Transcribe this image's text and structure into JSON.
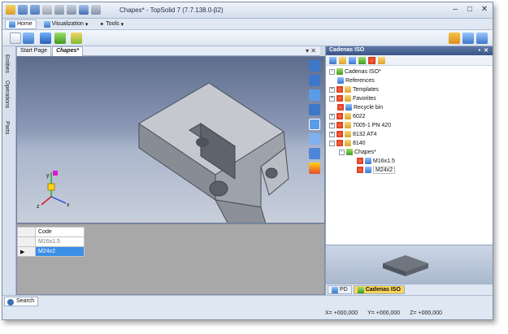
{
  "window": {
    "title": "Chapes* - TopSolid 7 (7.7.138.0-β2)"
  },
  "menu": {
    "tabs": [
      {
        "label": "Home"
      },
      {
        "label": "Visualization"
      },
      {
        "label": "Tools"
      }
    ]
  },
  "doc_tabs": [
    {
      "label": "Start Page"
    },
    {
      "label": "Chapes*"
    }
  ],
  "left_tabs": [
    {
      "label": "Entities"
    },
    {
      "label": "Operations"
    },
    {
      "label": "Parts"
    }
  ],
  "axes": {
    "y": "y",
    "x": "x",
    "z": "z"
  },
  "grid": {
    "header": "Code",
    "rows": [
      {
        "code": "M16x1.5"
      },
      {
        "code": "M24x2"
      }
    ]
  },
  "search": {
    "label": "Search"
  },
  "panel": {
    "title": "Cadenas ISO",
    "tree": [
      {
        "label": "Cadenas ISO*"
      },
      {
        "label": "References"
      },
      {
        "label": "Templates"
      },
      {
        "label": "Favorites"
      },
      {
        "label": "Recycle bin"
      },
      {
        "label": "6022"
      },
      {
        "label": "7005-1 PN 420"
      },
      {
        "label": "8132 AT4"
      },
      {
        "label": "8140"
      },
      {
        "label": "Chapes*"
      },
      {
        "label": "M16x1.5"
      },
      {
        "label": "M24x2"
      }
    ],
    "bottom_tabs": [
      {
        "label": "PD"
      },
      {
        "label": "Cadenas ISO"
      }
    ]
  },
  "status": {
    "x": "X= +000,000",
    "y": "Y= +000,000",
    "z": "Z= +000,000"
  }
}
